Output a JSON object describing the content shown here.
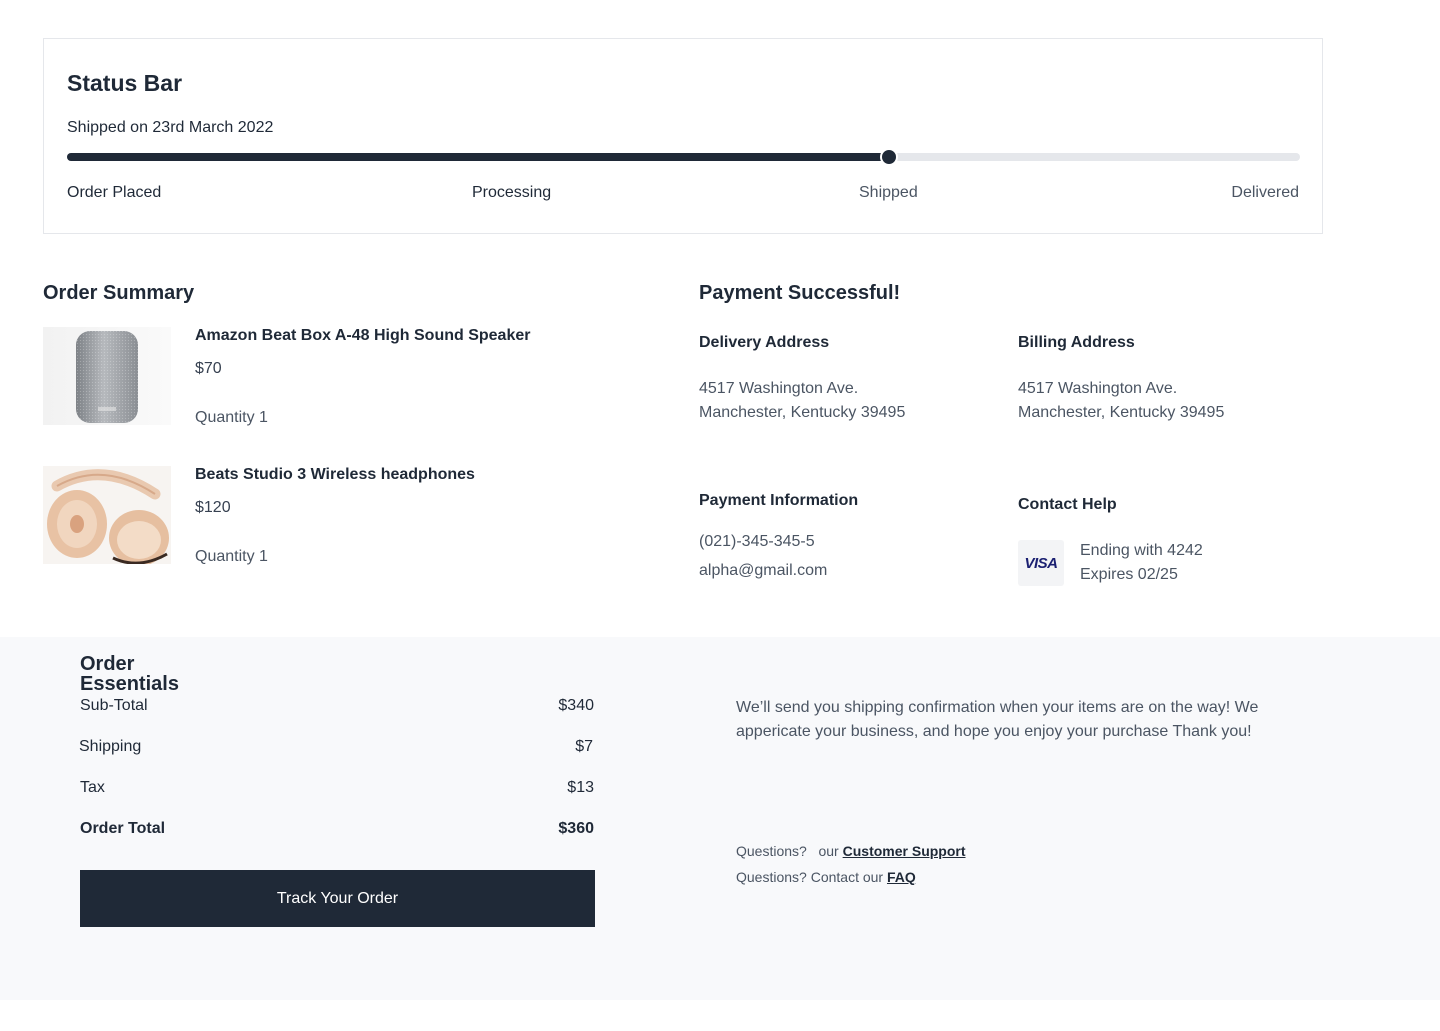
{
  "status": {
    "title": "Status Bar",
    "subtitle": "Shipped on 23rd March 2022",
    "progress": 0.667,
    "steps": [
      "Order Placed",
      "Processing",
      "Shipped",
      "Delivered"
    ]
  },
  "order_summary": {
    "title": "Order Summary",
    "items": [
      {
        "name": "Amazon Beat Box A-48 High Sound Speaker",
        "price": "$70",
        "quantity": "Quantity 1",
        "image": "speaker-image"
      },
      {
        "name": "Beats Studio 3 Wireless headphones",
        "price": "$120",
        "quantity": "Quantity 1",
        "image": "headphones-image"
      }
    ]
  },
  "payment": {
    "title": "Payment Successful!",
    "delivery": {
      "heading": "Delivery Address",
      "line1": "4517 Washington Ave.",
      "line2": "Manchester, Kentucky 39495"
    },
    "billing": {
      "heading": "Billing Address",
      "line1": "4517 Washington Ave.",
      "line2": "Manchester, Kentucky 39495"
    },
    "info": {
      "heading": "Payment Information",
      "phone": "(021)-345-345-5",
      "email": "alpha@gmail.com"
    },
    "contact": {
      "heading": "Contact Help",
      "card_brand": "VISA",
      "ending": "Ending with 4242",
      "expires": "Expires 02/25"
    }
  },
  "essentials": {
    "title": "Order Essentials",
    "rows": [
      {
        "label": "Sub-Total",
        "value": "$340"
      },
      {
        "label": "Shipping",
        "value": "$7"
      },
      {
        "label": "Tax",
        "value": "$13"
      }
    ],
    "total": {
      "label": "Order Total",
      "value": "$360"
    },
    "button": "Track Your Order"
  },
  "footer": {
    "message": "We’ll send you shipping  confirmation when your items are on the way! We appericate your business, and hope you enjoy your purchase Thank you!",
    "q1_prefix": "Questions?   our ",
    "q1_link": "Customer Support",
    "q2_prefix": "Questions? Contact our ",
    "q2_link": "FAQ"
  },
  "colors": {
    "primary": "#1f2937",
    "track": "#e5e7eb",
    "footer_bg": "#f8f9fb",
    "visa": "#1a1f71"
  }
}
